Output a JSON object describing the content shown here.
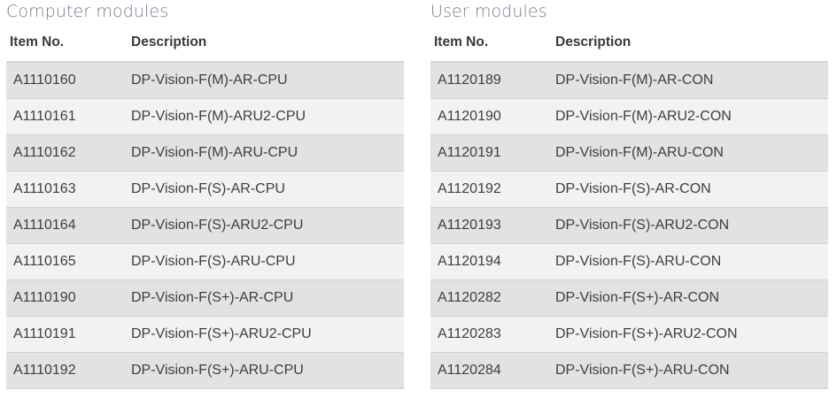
{
  "computer_modules": {
    "title": "Computer modules",
    "headers": {
      "item_no": "Item No.",
      "description": "Description"
    },
    "rows": [
      {
        "item_no": "A1110160",
        "description": "DP-Vision-F(M)-AR-CPU"
      },
      {
        "item_no": "A1110161",
        "description": "DP-Vision-F(M)-ARU2-CPU"
      },
      {
        "item_no": "A1110162",
        "description": "DP-Vision-F(M)-ARU-CPU"
      },
      {
        "item_no": "A1110163",
        "description": "DP-Vision-F(S)-AR-CPU"
      },
      {
        "item_no": "A1110164",
        "description": "DP-Vision-F(S)-ARU2-CPU"
      },
      {
        "item_no": "A1110165",
        "description": "DP-Vision-F(S)-ARU-CPU"
      },
      {
        "item_no": "A1110190",
        "description": "DP-Vision-F(S+)-AR-CPU"
      },
      {
        "item_no": "A1110191",
        "description": "DP-Vision-F(S+)-ARU2-CPU"
      },
      {
        "item_no": "A1110192",
        "description": "DP-Vision-F(S+)-ARU-CPU"
      }
    ]
  },
  "user_modules": {
    "title": "User modules",
    "headers": {
      "item_no": "Item No.",
      "description": "Description"
    },
    "rows": [
      {
        "item_no": "A1120189",
        "description": "DP-Vision-F(M)-AR-CON"
      },
      {
        "item_no": "A1120190",
        "description": "DP-Vision-F(M)-ARU2-CON"
      },
      {
        "item_no": "A1120191",
        "description": "DP-Vision-F(M)-ARU-CON"
      },
      {
        "item_no": "A1120192",
        "description": "DP-Vision-F(S)-AR-CON"
      },
      {
        "item_no": "A1120193",
        "description": "DP-Vision-F(S)-ARU2-CON"
      },
      {
        "item_no": "A1120194",
        "description": "DP-Vision-F(S)-ARU-CON"
      },
      {
        "item_no": "A1120282",
        "description": "DP-Vision-F(S+)-AR-CON"
      },
      {
        "item_no": "A1120283",
        "description": "DP-Vision-F(S+)-ARU2-CON"
      },
      {
        "item_no": "A1120284",
        "description": "DP-Vision-F(S+)-ARU-CON"
      }
    ]
  }
}
